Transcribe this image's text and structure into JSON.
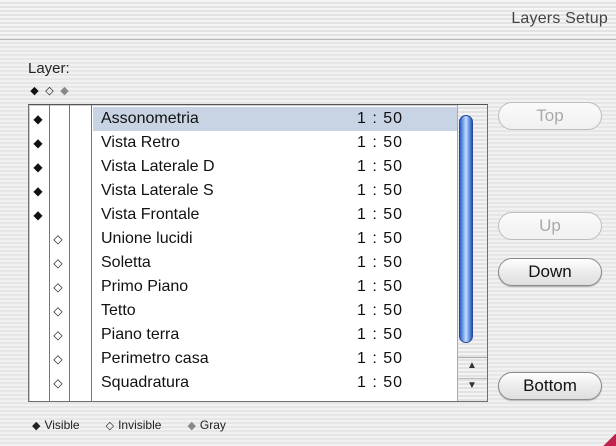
{
  "window": {
    "title": "Layers Setup"
  },
  "layer_label": "Layer:",
  "header_symbols": {
    "visible": "◆",
    "invisible": "◇",
    "gray": "◆"
  },
  "layers": [
    {
      "visible": "◆",
      "invisible": "",
      "name": "Assonometria",
      "scale": "1 : 50",
      "selected": true
    },
    {
      "visible": "◆",
      "invisible": "",
      "name": "Vista Retro",
      "scale": "1 : 50"
    },
    {
      "visible": "◆",
      "invisible": "",
      "name": "Vista Laterale D",
      "scale": "1 : 50"
    },
    {
      "visible": "◆",
      "invisible": "",
      "name": "Vista Laterale S",
      "scale": "1 : 50"
    },
    {
      "visible": "◆",
      "invisible": "",
      "name": "Vista Frontale",
      "scale": "1 : 50"
    },
    {
      "visible": "",
      "invisible": "◇",
      "name": "Unione lucidi",
      "scale": "1 : 50"
    },
    {
      "visible": "",
      "invisible": "◇",
      "name": "Soletta",
      "scale": "1 : 50"
    },
    {
      "visible": "",
      "invisible": "◇",
      "name": "Primo Piano",
      "scale": "1 : 50"
    },
    {
      "visible": "",
      "invisible": "◇",
      "name": "Tetto",
      "scale": "1 : 50"
    },
    {
      "visible": "",
      "invisible": "◇",
      "name": "Piano terra",
      "scale": "1 : 50"
    },
    {
      "visible": "",
      "invisible": "◇",
      "name": "Perimetro casa",
      "scale": "1 : 50"
    },
    {
      "visible": "",
      "invisible": "◇",
      "name": "Squadratura",
      "scale": "1 : 50"
    }
  ],
  "buttons": {
    "top": "Top",
    "up": "Up",
    "down": "Down",
    "bottom": "Bottom"
  },
  "scrollbar": {
    "up_arrow_icon": "arrow-up-icon",
    "down_arrow_icon": "arrow-down-icon"
  },
  "legend": {
    "visible_symbol": "◆",
    "visible_label": "Visible",
    "invisible_symbol": "◇",
    "invisible_label": "Invisible",
    "gray_symbol": "◆",
    "gray_label": "Gray"
  },
  "colors": {
    "selection": "#c8d3e3",
    "scroll_thumb": "#4a7fdc",
    "gray_symbol": "#888888"
  }
}
